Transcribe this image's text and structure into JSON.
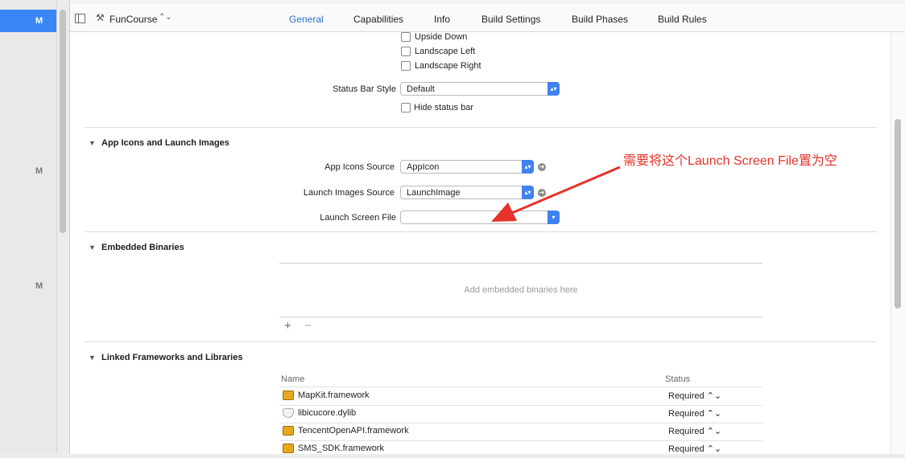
{
  "navigator": {
    "badges": [
      "M",
      "M",
      "M"
    ]
  },
  "toolbar": {
    "target_name": "FunCourse",
    "target_chevron": "⌃⌄"
  },
  "tabs": [
    {
      "label": "General",
      "active": true
    },
    {
      "label": "Capabilities"
    },
    {
      "label": "Info"
    },
    {
      "label": "Build Settings"
    },
    {
      "label": "Build Phases"
    },
    {
      "label": "Build Rules"
    }
  ],
  "orientation": {
    "upside_down": "Upside Down",
    "landscape_left": "Landscape Left",
    "landscape_right": "Landscape Right"
  },
  "status_bar": {
    "style_label": "Status Bar Style",
    "style_value": "Default",
    "hide_label": "Hide status bar"
  },
  "app_icons": {
    "section_title": "App Icons and Launch Images",
    "icons_source_label": "App Icons Source",
    "icons_source_value": "AppIcon",
    "launch_images_label": "Launch Images Source",
    "launch_images_value": "LaunchImage",
    "launch_screen_label": "Launch Screen File",
    "launch_screen_value": ""
  },
  "embedded": {
    "section_title": "Embedded Binaries",
    "placeholder": "Add embedded binaries here",
    "add": "+",
    "remove": "−"
  },
  "linked": {
    "section_title": "Linked Frameworks and Libraries",
    "col_name": "Name",
    "col_status": "Status",
    "rows": [
      {
        "name": "MapKit.framework",
        "status": "Required ⌃⌄",
        "icon": "framework-icon"
      },
      {
        "name": "libicucore.dylib",
        "status": "Required ⌃⌄",
        "icon": "dylib-icon"
      },
      {
        "name": "TencentOpenAPI.framework",
        "status": "Required ⌃⌄",
        "icon": "framework-icon"
      },
      {
        "name": "SMS_SDK.framework",
        "status": "Required ⌃⌄",
        "icon": "framework-icon"
      }
    ]
  },
  "annotation": {
    "text": "需要将这个Launch Screen File置为空",
    "color": "#e5332a"
  },
  "colors": {
    "accent": "#3b86f5",
    "active_tab": "#2c6fd6"
  }
}
